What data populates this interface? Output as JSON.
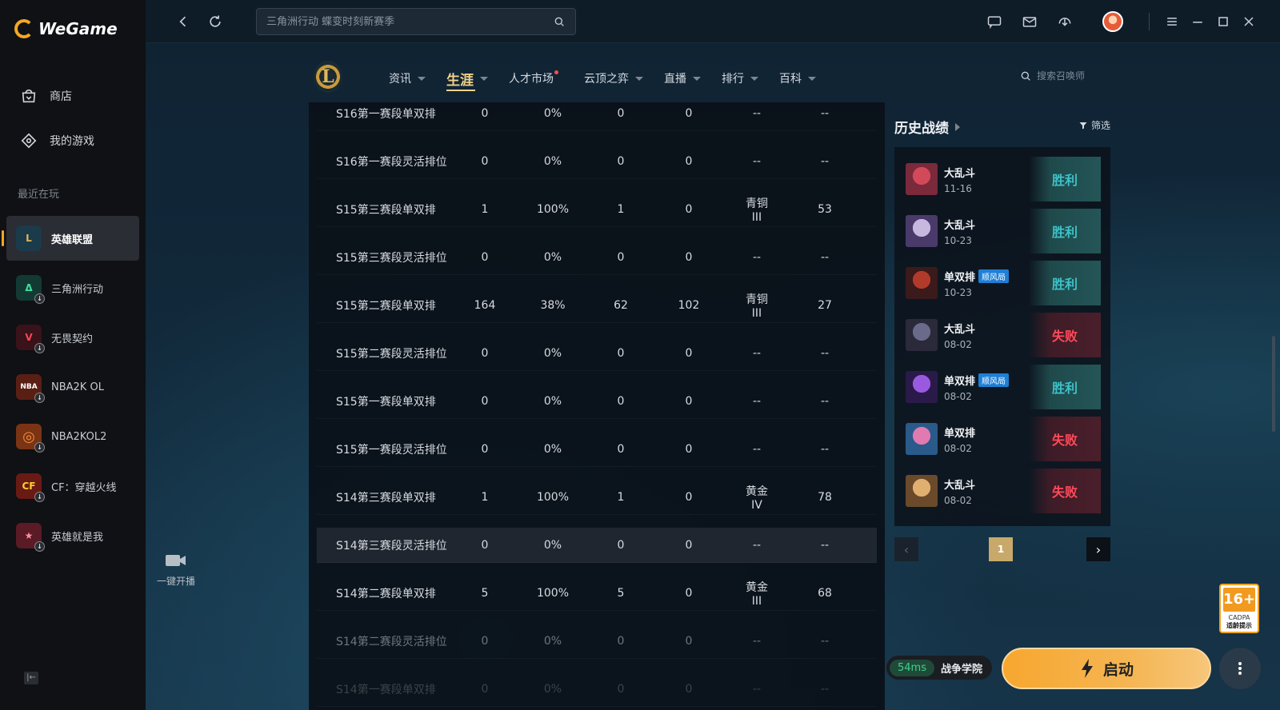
{
  "app": {
    "name": "WeGame"
  },
  "sidebar": {
    "items": [
      {
        "label": "商店",
        "icon": "store-icon"
      },
      {
        "label": "我的游戏",
        "icon": "gamepad-icon"
      }
    ],
    "recent_label": "最近在玩",
    "games": [
      {
        "label": "英雄联盟",
        "color": "#1b3a4a",
        "text": "L",
        "active": true
      },
      {
        "label": "三角洲行动",
        "color": "#123a33",
        "text": "Δ",
        "download": true
      },
      {
        "label": "无畏契约",
        "color": "#3a1219",
        "text": "V",
        "download": true
      },
      {
        "label": "NBA2K OL",
        "color": "#5a1f14",
        "text": "NBA",
        "download": true
      },
      {
        "label": "NBA2KOL2",
        "color": "#7a3414",
        "text": "◎",
        "download": true
      },
      {
        "label": "CF：穿越火线",
        "color": "#6a1a14",
        "text": "CF",
        "download": true
      },
      {
        "label": "英雄就是我",
        "color": "#5a1a26",
        "text": "★",
        "download": true
      }
    ]
  },
  "topbar": {
    "search_placeholder": "三角洲行动 蝶变时刻新赛季"
  },
  "game_nav": {
    "logo_text": "L",
    "items": [
      {
        "label": "资讯",
        "caret": true
      },
      {
        "label": "生涯",
        "caret": true,
        "active": true
      },
      {
        "label": "人才市场",
        "dot": true
      },
      {
        "label": "云顶之弈",
        "caret": true
      },
      {
        "label": "直播",
        "caret": true
      },
      {
        "label": "排行",
        "caret": true
      },
      {
        "label": "百科",
        "caret": true
      }
    ],
    "summoner_search_placeholder": "搜索召唤师"
  },
  "season_table": {
    "rows": [
      [
        "S16第一赛段单双排",
        "0",
        "0%",
        "0",
        "0",
        "--",
        "--"
      ],
      [
        "S16第一赛段灵活排位",
        "0",
        "0%",
        "0",
        "0",
        "--",
        "--"
      ],
      [
        "S15第三赛段单双排",
        "1",
        "100%",
        "1",
        "0",
        "青铜 III",
        "53"
      ],
      [
        "S15第三赛段灵活排位",
        "0",
        "0%",
        "0",
        "0",
        "--",
        "--"
      ],
      [
        "S15第二赛段单双排",
        "164",
        "38%",
        "62",
        "102",
        "青铜 III",
        "27"
      ],
      [
        "S15第二赛段灵活排位",
        "0",
        "0%",
        "0",
        "0",
        "--",
        "--"
      ],
      [
        "S15第一赛段单双排",
        "0",
        "0%",
        "0",
        "0",
        "--",
        "--"
      ],
      [
        "S15第一赛段灵活排位",
        "0",
        "0%",
        "0",
        "0",
        "--",
        "--"
      ],
      [
        "S14第三赛段单双排",
        "1",
        "100%",
        "1",
        "0",
        "黄金 IV",
        "78"
      ],
      [
        "S14第三赛段灵活排位",
        "0",
        "0%",
        "0",
        "0",
        "--",
        "--"
      ],
      [
        "S14第二赛段单双排",
        "5",
        "100%",
        "5",
        "0",
        "黄金 III",
        "68"
      ],
      [
        "S14第二赛段灵活排位",
        "0",
        "0%",
        "0",
        "0",
        "--",
        "--"
      ],
      [
        "S14第一赛段单双排",
        "0",
        "0%",
        "0",
        "0",
        "--",
        "--"
      ]
    ]
  },
  "history": {
    "title": "历史战绩",
    "filter_label": "筛选",
    "matches": [
      {
        "mode": "大乱斗",
        "date": "11-16",
        "result": "胜利",
        "win": true,
        "c1": "#7a2a3a",
        "c2": "#d24a5a"
      },
      {
        "mode": "大乱斗",
        "date": "10-23",
        "result": "胜利",
        "win": true,
        "c1": "#4a3a6a",
        "c2": "#c8b8e0"
      },
      {
        "mode": "单双排",
        "tag": "顺风局",
        "date": "10-23",
        "result": "胜利",
        "win": true,
        "c1": "#3a1a1a",
        "c2": "#b23a2a"
      },
      {
        "mode": "大乱斗",
        "date": "08-02",
        "result": "失败",
        "win": false,
        "c1": "#2a2a3a",
        "c2": "#6a6a8a"
      },
      {
        "mode": "单双排",
        "tag": "顺风局",
        "date": "08-02",
        "result": "胜利",
        "win": true,
        "c1": "#2a1a4a",
        "c2": "#9a5ae0"
      },
      {
        "mode": "单双排",
        "date": "08-02",
        "result": "失败",
        "win": false,
        "c1": "#2a5a8a",
        "c2": "#e07ab0"
      },
      {
        "mode": "大乱斗",
        "date": "08-02",
        "result": "失败",
        "win": false,
        "c1": "#6a4a2a",
        "c2": "#e0b070"
      }
    ],
    "page": "1"
  },
  "live": {
    "label": "一键开播"
  },
  "launch": {
    "ping": "54ms",
    "server": "战争学院",
    "label": "启动"
  },
  "age_rating": {
    "num": "16+",
    "sub": "CADPA",
    "hint": "适龄提示"
  }
}
